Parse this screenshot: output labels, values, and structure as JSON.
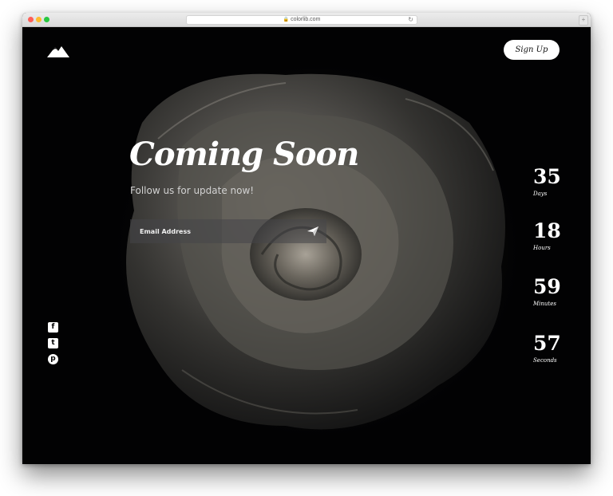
{
  "browser": {
    "url": "colorlib.com",
    "lock_glyph": "🔒",
    "reload_glyph": "↻",
    "newtab_glyph": "+"
  },
  "header": {
    "logo_icon": "mountain-icon",
    "signup_label": "Sign Up"
  },
  "hero": {
    "title": "Coming Soon",
    "subtitle": "Follow us for update now!",
    "email_placeholder": "Email Address",
    "send_icon": "paper-plane-icon"
  },
  "social": [
    {
      "icon": "facebook-icon",
      "glyph": "f"
    },
    {
      "icon": "twitter-icon",
      "glyph": "t"
    },
    {
      "icon": "pinterest-icon",
      "glyph": "p"
    }
  ],
  "countdown": [
    {
      "value": "35",
      "label": "Days"
    },
    {
      "value": "18",
      "label": "Hours"
    },
    {
      "value": "59",
      "label": "Minutes"
    },
    {
      "value": "57",
      "label": "Seconds"
    }
  ],
  "colors": {
    "background": "#020203",
    "accent": "#ffffff",
    "input_bg": "#464648"
  }
}
